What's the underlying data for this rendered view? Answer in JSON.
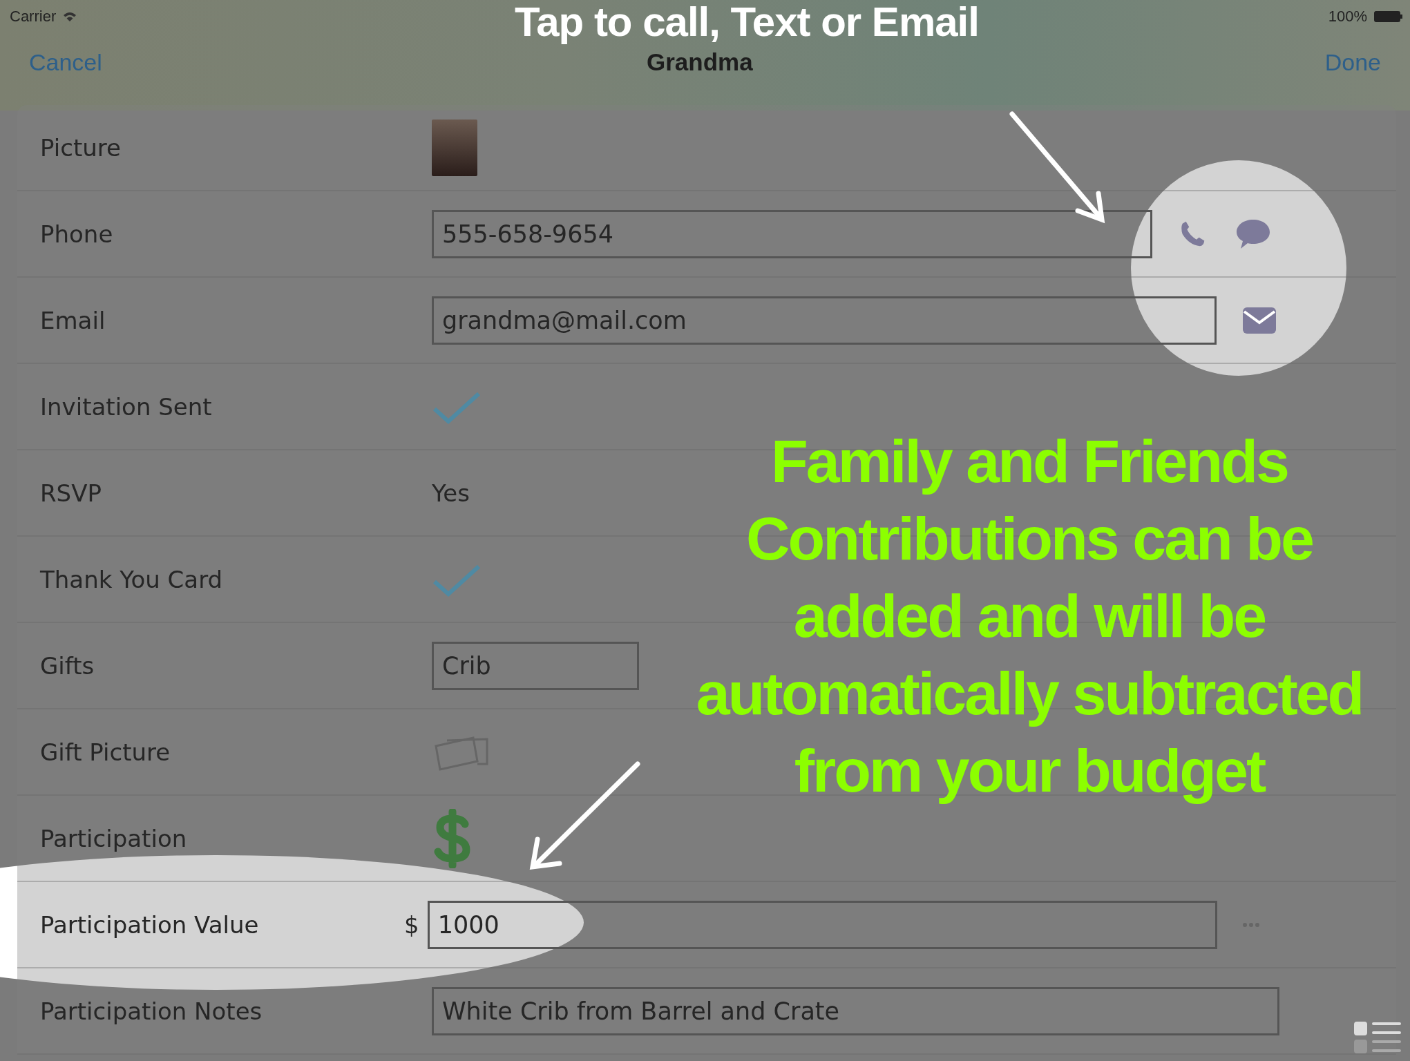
{
  "status_bar": {
    "carrier": "Carrier",
    "battery": "100%"
  },
  "nav": {
    "cancel": "Cancel",
    "title": "Grandma",
    "done": "Done"
  },
  "rows": [
    {
      "label": "Picture",
      "kind": "photo"
    },
    {
      "label": "Phone",
      "kind": "phone",
      "value": "555-658-9654"
    },
    {
      "label": "Email",
      "kind": "email",
      "value": "grandma@mail.com"
    },
    {
      "label": "Invitation Sent",
      "kind": "check",
      "checked": true
    },
    {
      "label": "RSVP",
      "kind": "text",
      "value": "Yes"
    },
    {
      "label": "Thank You Card",
      "kind": "check",
      "checked": true
    },
    {
      "label": "Gifts",
      "kind": "field",
      "value": "Crib"
    },
    {
      "label": "Gift Picture",
      "kind": "picture-picker"
    },
    {
      "label": "Participation",
      "kind": "dollar"
    },
    {
      "label": "Participation Value",
      "kind": "amount",
      "prefix": "$",
      "value": "1000"
    },
    {
      "label": "Participation Notes",
      "kind": "field",
      "value": "White Crib from Barrel and Crate"
    }
  ],
  "annotations": [
    {
      "kind": "title",
      "text": "Tap to call, Text or Email"
    },
    {
      "kind": "callout",
      "text": "Family and Friends Contributions can be added and will be automatically subtracted from your budget"
    }
  ]
}
